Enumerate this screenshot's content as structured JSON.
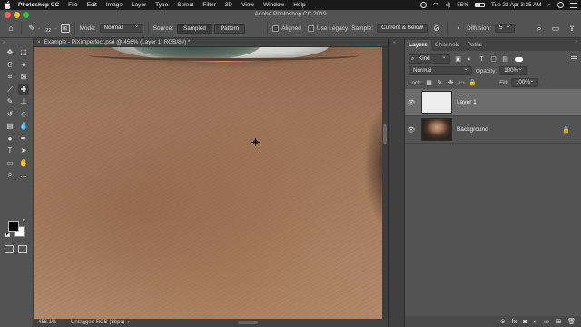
{
  "menubar": {
    "app": "Photoshop CC",
    "items": [
      "File",
      "Edit",
      "Image",
      "Layer",
      "Type",
      "Select",
      "Filter",
      "3D",
      "View",
      "Window",
      "Help"
    ],
    "battery": "55%",
    "battery_level": 0.55,
    "datetime": "Tue 23 Apr  3:35 AM"
  },
  "window": {
    "title": "Adobe Photoshop CC 2019",
    "traffic_colors": [
      "#ff5f57",
      "#febc2e",
      "#28c840"
    ]
  },
  "options": {
    "brush_size": "22",
    "mode_label": "Mode:",
    "mode_value": "Normal",
    "source_label": "Source:",
    "source_sampled": "Sampled",
    "source_pattern": "Pattern",
    "aligned": "Aligned",
    "use_legacy": "Use Legacy",
    "sample_label": "Sample:",
    "sample_value": "Current & Below",
    "diffusion_label": "Diffusion:",
    "diffusion_value": "5"
  },
  "document": {
    "tab_title": "Example - PiXimperfect.psd @ 456% (Layer 1, RGB/8#) *",
    "zoom": "456.1%",
    "profile": "Untagged RGB (8bpc)"
  },
  "tools": [
    "move",
    "marquee",
    "lasso",
    "magic-wand",
    "crop",
    "frame",
    "eyedropper",
    "healing-brush",
    "brush",
    "stamp",
    "history-brush",
    "eraser",
    "gradient",
    "blur",
    "dodge",
    "pen",
    "type",
    "path-select",
    "rectangle",
    "hand",
    "zoom",
    "more"
  ],
  "panel": {
    "tabs": [
      "Layers",
      "Channels",
      "Paths"
    ],
    "kind_value": "Kind",
    "blend_mode": "Normal",
    "opacity_label": "Opacity:",
    "opacity_value": "100%",
    "lock_label": "Lock:",
    "fill_label": "Fill:",
    "fill_value": "100%",
    "layers": [
      {
        "name": "Layer 1",
        "selected": true,
        "visible": true
      },
      {
        "name": "Background",
        "selected": false,
        "visible": true,
        "locked": true
      }
    ],
    "footer_icons": [
      "link-icon",
      "fx-icon",
      "mask-icon",
      "adjustment-icon",
      "group-icon",
      "new-layer-icon",
      "trash-icon"
    ],
    "footer_fx": "fx"
  }
}
